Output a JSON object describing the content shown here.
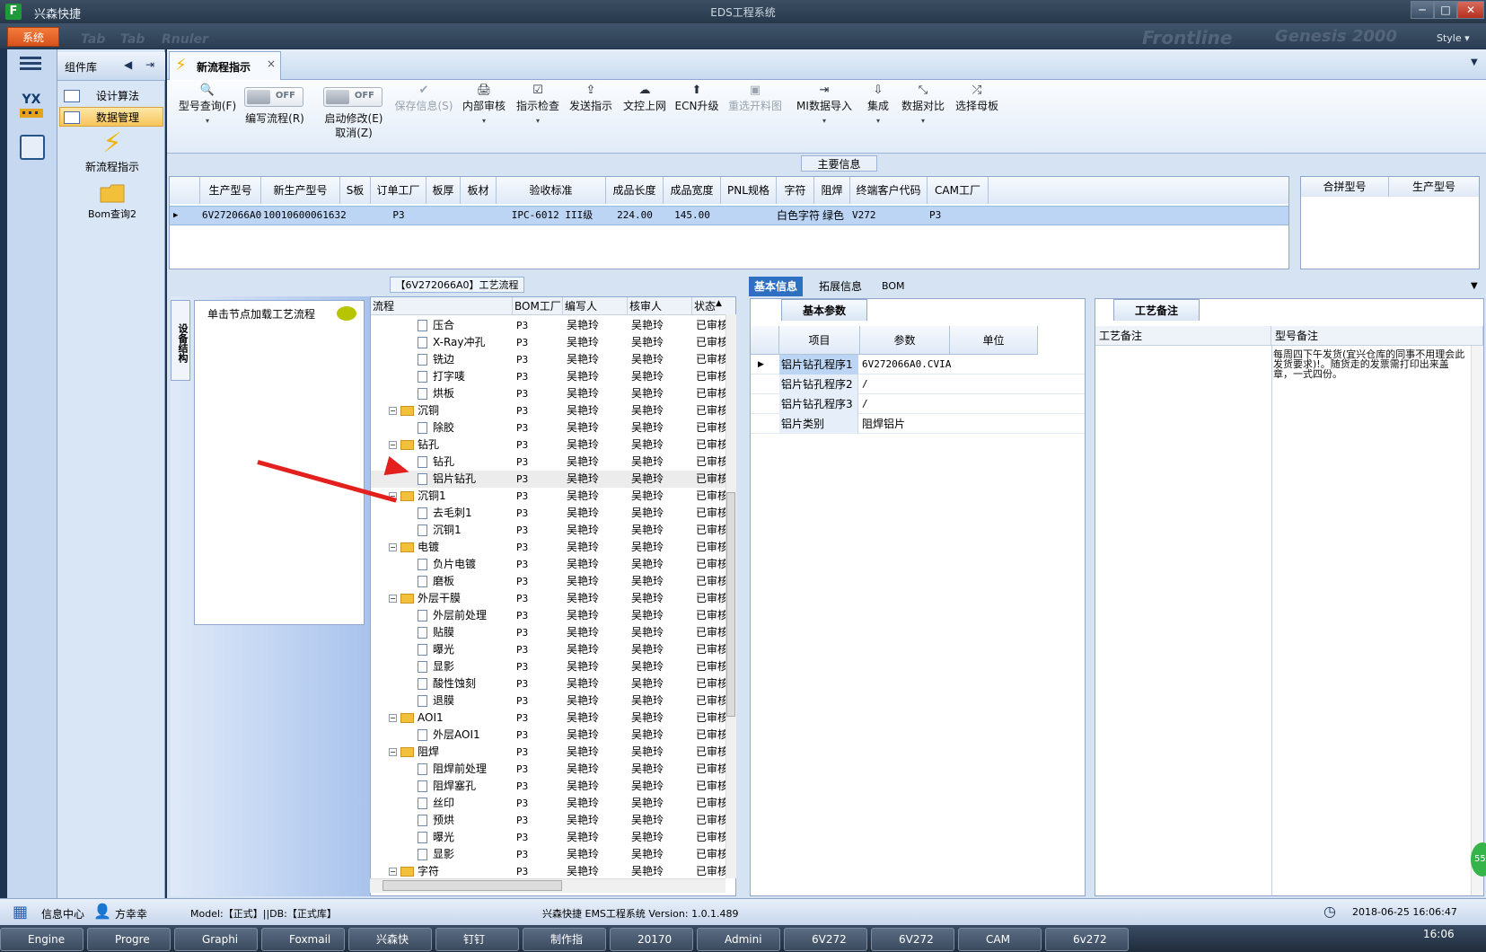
{
  "window": {
    "app_name": "兴森快捷",
    "title": "EDS工程系统",
    "logo": "F",
    "min": "─",
    "max": "□",
    "close": "✕"
  },
  "menu": {
    "system": "系统",
    "ghost": [
      "Tab",
      "Tab",
      "Rnuler",
      "Frontline",
      "Genesis 2000"
    ],
    "style": "Style ▾"
  },
  "lib": {
    "title": "组件库",
    "items": [
      {
        "label": "设计算法"
      },
      {
        "label": "数据管理"
      }
    ],
    "big": [
      {
        "label": "新流程指示"
      },
      {
        "label": "Bom查询2"
      }
    ],
    "yx": "YX"
  },
  "doctab": {
    "label": "新流程指示",
    "close": "×"
  },
  "ribbon": {
    "buttons": [
      {
        "label": "型号查询(F)",
        "icon": "🔍"
      },
      {
        "label": "编写流程(R)"
      },
      {
        "label": "启动修改(E)",
        "label2": "取消(Z)"
      },
      {
        "label": "保存信息(S)",
        "icon": "✔"
      },
      {
        "label": "内部审核",
        "icon": "🖨"
      },
      {
        "label": "指示检查",
        "icon": "☑"
      },
      {
        "label": "发送指示",
        "icon": "⇪"
      },
      {
        "label": "文控上网",
        "icon": "☁"
      },
      {
        "label": "ECN升级",
        "icon": "⬆"
      },
      {
        "label": "重选开料图",
        "icon": "▣"
      },
      {
        "label": "MI数据导入",
        "icon": "⇥"
      },
      {
        "label": "集成",
        "icon": "⇩"
      },
      {
        "label": "数据对比",
        "icon": "⤡"
      },
      {
        "label": "选择母板",
        "icon": "⤮"
      }
    ],
    "toggle_off": "OFF",
    "dropdown": "▾"
  },
  "main_info": {
    "label": "主要信息",
    "columns": [
      "生产型号",
      "新生产型号",
      "S板",
      "订单工厂",
      "板厚",
      "板材",
      "验收标准",
      "成品长度",
      "成品宽度",
      "PNL规格",
      "字符",
      "阻焊",
      "终端客户代码",
      "CAM工厂"
    ],
    "row": [
      "6V272066A0",
      "10010600061632",
      "",
      "P3",
      "",
      "",
      "IPC-6012 III级",
      "224.00",
      "145.00",
      "",
      "白色字符",
      "绿色",
      "V272",
      "P3"
    ],
    "right_columns": [
      "合拼型号",
      "生产型号"
    ]
  },
  "flow": {
    "title": "【6V272066A0】工艺流程",
    "vtab": "设备结构",
    "hint": "单击节点加载工艺流程",
    "columns": [
      "流程",
      "BOM工厂",
      "编写人",
      "核审人",
      "状态"
    ],
    "rows": [
      {
        "name": "压合",
        "type": "doc",
        "factory": "P3",
        "writer": "吴艳玲",
        "reviewer": "吴艳玲",
        "status": "已审核"
      },
      {
        "name": "X-Ray冲孔",
        "type": "doc",
        "factory": "P3",
        "writer": "吴艳玲",
        "reviewer": "吴艳玲",
        "status": "已审核"
      },
      {
        "name": "铣边",
        "type": "doc",
        "factory": "P3",
        "writer": "吴艳玲",
        "reviewer": "吴艳玲",
        "status": "已审核"
      },
      {
        "name": "打字唛",
        "type": "doc",
        "factory": "P3",
        "writer": "吴艳玲",
        "reviewer": "吴艳玲",
        "status": "已审核"
      },
      {
        "name": "烘板",
        "type": "doc",
        "factory": "P3",
        "writer": "吴艳玲",
        "reviewer": "吴艳玲",
        "status": "已审核"
      },
      {
        "name": "沉铜",
        "type": "folder",
        "factory": "P3",
        "writer": "吴艳玲",
        "reviewer": "吴艳玲",
        "status": "已审核"
      },
      {
        "name": "除胶",
        "type": "doc",
        "factory": "P3",
        "writer": "吴艳玲",
        "reviewer": "吴艳玲",
        "status": "已审核"
      },
      {
        "name": "钻孔",
        "type": "folder",
        "factory": "P3",
        "writer": "吴艳玲",
        "reviewer": "吴艳玲",
        "status": "已审核"
      },
      {
        "name": "钻孔",
        "type": "doc",
        "factory": "P3",
        "writer": "吴艳玲",
        "reviewer": "吴艳玲",
        "status": "已审核"
      },
      {
        "name": "铝片钻孔",
        "type": "doc",
        "factory": "P3",
        "writer": "吴艳玲",
        "reviewer": "吴艳玲",
        "status": "已审核",
        "selected": true
      },
      {
        "name": "沉铜1",
        "type": "folder",
        "factory": "P3",
        "writer": "吴艳玲",
        "reviewer": "吴艳玲",
        "status": "已审核"
      },
      {
        "name": "去毛刺1",
        "type": "doc",
        "factory": "P3",
        "writer": "吴艳玲",
        "reviewer": "吴艳玲",
        "status": "已审核"
      },
      {
        "name": "沉铜1",
        "type": "doc",
        "factory": "P3",
        "writer": "吴艳玲",
        "reviewer": "吴艳玲",
        "status": "已审核"
      },
      {
        "name": "电镀",
        "type": "folder",
        "factory": "P3",
        "writer": "吴艳玲",
        "reviewer": "吴艳玲",
        "status": "已审核"
      },
      {
        "name": "负片电镀",
        "type": "doc",
        "factory": "P3",
        "writer": "吴艳玲",
        "reviewer": "吴艳玲",
        "status": "已审核"
      },
      {
        "name": "磨板",
        "type": "doc",
        "factory": "P3",
        "writer": "吴艳玲",
        "reviewer": "吴艳玲",
        "status": "已审核"
      },
      {
        "name": "外层干膜",
        "type": "folder",
        "factory": "P3",
        "writer": "吴艳玲",
        "reviewer": "吴艳玲",
        "status": "已审核"
      },
      {
        "name": "外层前处理",
        "type": "doc",
        "factory": "P3",
        "writer": "吴艳玲",
        "reviewer": "吴艳玲",
        "status": "已审核"
      },
      {
        "name": "贴膜",
        "type": "doc",
        "factory": "P3",
        "writer": "吴艳玲",
        "reviewer": "吴艳玲",
        "status": "已审核"
      },
      {
        "name": "曝光",
        "type": "doc",
        "factory": "P3",
        "writer": "吴艳玲",
        "reviewer": "吴艳玲",
        "status": "已审核"
      },
      {
        "name": "显影",
        "type": "doc",
        "factory": "P3",
        "writer": "吴艳玲",
        "reviewer": "吴艳玲",
        "status": "已审核"
      },
      {
        "name": "酸性蚀刻",
        "type": "doc",
        "factory": "P3",
        "writer": "吴艳玲",
        "reviewer": "吴艳玲",
        "status": "已审核"
      },
      {
        "name": "退膜",
        "type": "doc",
        "factory": "P3",
        "writer": "吴艳玲",
        "reviewer": "吴艳玲",
        "status": "已审核"
      },
      {
        "name": "AOI1",
        "type": "folder",
        "factory": "P3",
        "writer": "吴艳玲",
        "reviewer": "吴艳玲",
        "status": "已审核"
      },
      {
        "name": "外层AOI1",
        "type": "doc",
        "factory": "P3",
        "writer": "吴艳玲",
        "reviewer": "吴艳玲",
        "status": "已审核"
      },
      {
        "name": "阻焊",
        "type": "folder",
        "factory": "P3",
        "writer": "吴艳玲",
        "reviewer": "吴艳玲",
        "status": "已审核"
      },
      {
        "name": "阻焊前处理",
        "type": "doc",
        "factory": "P3",
        "writer": "吴艳玲",
        "reviewer": "吴艳玲",
        "status": "已审核"
      },
      {
        "name": "阻焊塞孔",
        "type": "doc",
        "factory": "P3",
        "writer": "吴艳玲",
        "reviewer": "吴艳玲",
        "status": "已审核"
      },
      {
        "name": "丝印",
        "type": "doc",
        "factory": "P3",
        "writer": "吴艳玲",
        "reviewer": "吴艳玲",
        "status": "已审核"
      },
      {
        "name": "预烘",
        "type": "doc",
        "factory": "P3",
        "writer": "吴艳玲",
        "reviewer": "吴艳玲",
        "status": "已审核"
      },
      {
        "name": "曝光",
        "type": "doc",
        "factory": "P3",
        "writer": "吴艳玲",
        "reviewer": "吴艳玲",
        "status": "已审核"
      },
      {
        "name": "显影",
        "type": "doc",
        "factory": "P3",
        "writer": "吴艳玲",
        "reviewer": "吴艳玲",
        "status": "已审核"
      },
      {
        "name": "字符",
        "type": "folder",
        "factory": "P3",
        "writer": "吴艳玲",
        "reviewer": "吴艳玲",
        "status": "已审核"
      }
    ]
  },
  "right": {
    "tabs": [
      "基本信息",
      "拓展信息",
      "BOM"
    ],
    "basic_tab": "基本参数",
    "param_columns": [
      "项目",
      "参数",
      "单位"
    ],
    "params": [
      {
        "item": "铝片钻孔程序1",
        "value": "6V272066A0.CVIA",
        "unit": ""
      },
      {
        "item": "铝片钻孔程序2",
        "value": "/",
        "unit": ""
      },
      {
        "item": "铝片钻孔程序3",
        "value": "/",
        "unit": ""
      },
      {
        "item": "铝片类别",
        "value": "阻焊铝片",
        "unit": ""
      }
    ],
    "memo_tab": "工艺备注",
    "memo_columns": [
      "工艺备注",
      "型号备注"
    ],
    "model_note": "每周四下午发货(宜兴仓库的同事不用理会此发货要求)!。随货走的发票需打印出来盖章，一式四份。"
  },
  "status": {
    "info_center": "信息中心",
    "user": "方幸幸",
    "model": "Model:【正式】||DB:【正式库】",
    "version": "兴森快捷 EMS工程系统 Version: 1.0.1.489",
    "datetime": "2018-06-25 16:06:47"
  },
  "taskbar": {
    "items": [
      "Engine",
      "Progre",
      "Graphi",
      "Foxmail",
      "兴森快",
      "钉钉",
      "制作指",
      "20170",
      "Admini",
      "6V272",
      "6V272",
      "CAM",
      "6v272"
    ],
    "time": "16:06"
  },
  "badge": "55"
}
